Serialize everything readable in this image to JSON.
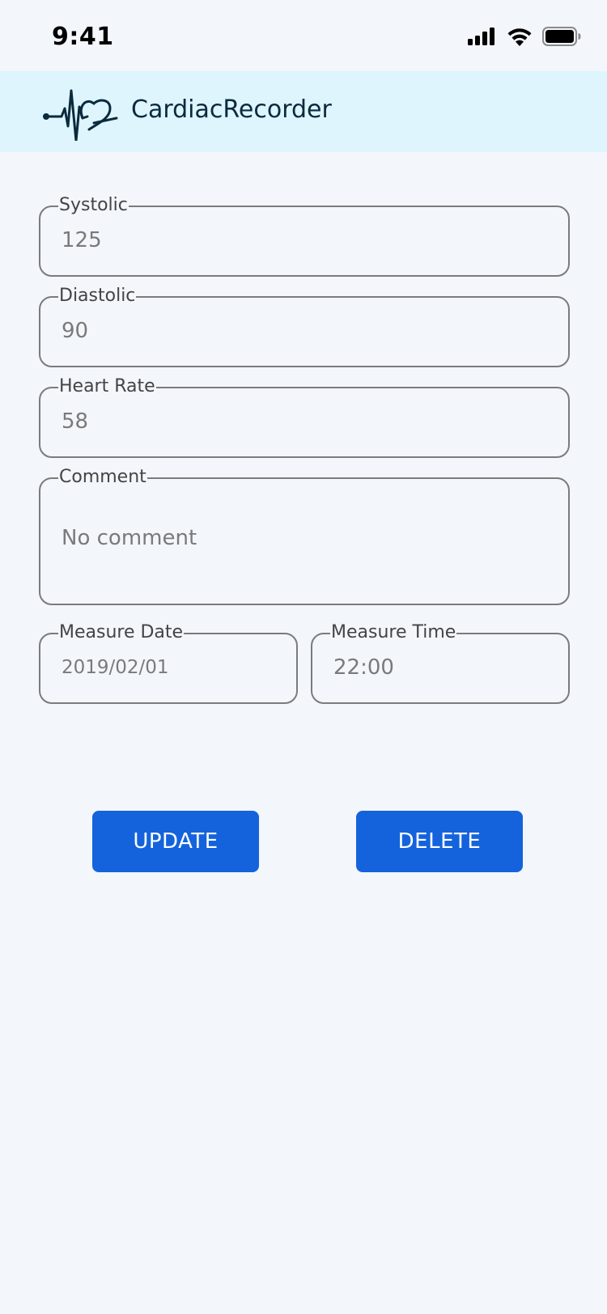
{
  "status_bar": {
    "time": "9:41",
    "icons": [
      "signal-icon",
      "wifi-icon",
      "battery-icon"
    ]
  },
  "app_bar": {
    "title": "CardiacRecorder",
    "logo": "heartbeat-logo-icon",
    "background": "#def5fd",
    "text_color": "#0b2a3e"
  },
  "form": {
    "systolic": {
      "label": "Systolic",
      "value": "125"
    },
    "diastolic": {
      "label": "Diastolic",
      "value": "90"
    },
    "heart_rate": {
      "label": "Heart Rate",
      "value": "58"
    },
    "comment": {
      "label": "Comment",
      "value": "No comment"
    },
    "measure_date": {
      "label": "Measure Date",
      "value": "2019/02/01"
    },
    "measure_time": {
      "label": "Measure Time",
      "value": "22:00"
    }
  },
  "actions": {
    "update_label": "UPDATE",
    "delete_label": "DELETE",
    "button_color": "#1463dd"
  },
  "colors": {
    "background": "#f3f6fb",
    "field_border": "#7b7b7b",
    "value_text": "#7a7a7a"
  }
}
